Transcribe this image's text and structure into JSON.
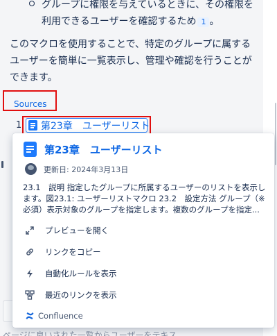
{
  "content": {
    "bullet_text": "グループに権限を与えているときに、その権限を利用できるユーザーを確認するため",
    "bullet_ref": "1",
    "bullet_tail": "。",
    "paragraph": "このマクロを使用することで、特定のグループに属するユーザーを簡単に一覧表示し、管理や確認を行うことができます。",
    "sources_label": "Sources",
    "source_number": "1",
    "source_link_text": "第23章　ユーザーリスト"
  },
  "popup": {
    "title": "第23章　ユーザーリスト",
    "updated": "更新日: 2024年3月13日",
    "excerpt": "23.1　説明 指定したグループに所属するユーザーのリストを表示します。図23.1: ユーザーリストマクロ 23.2　設定方法 グループ（※必須）表示対象のグループを指定します。複数のグループを指定...",
    "menu": [
      {
        "label": "プレビューを開く",
        "icon": "expand-icon"
      },
      {
        "label": "リンクをコピー",
        "icon": "link-icon"
      },
      {
        "label": "自動化ルールを表示",
        "icon": "lightning-icon"
      },
      {
        "label": "最近のリンクを表示",
        "icon": "hierarchy-icon"
      }
    ],
    "footer": "Confluence"
  },
  "bottom_fragment": "ページに良いされた一覧からユーザーをテキス..."
}
